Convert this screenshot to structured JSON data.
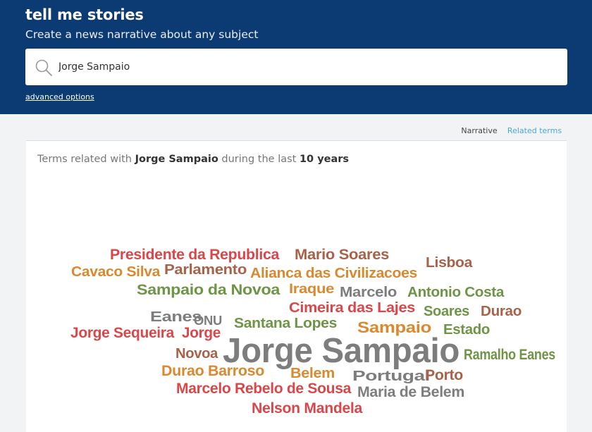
{
  "header": {
    "title": "tell me stories",
    "subtitle": "Create a news narrative about any subject",
    "advanced_link": "advanced options"
  },
  "search": {
    "value": "Jorge Sampaio",
    "icon": "search-icon"
  },
  "tabs": [
    {
      "label": "Narrative",
      "active": false
    },
    {
      "label": "Related terms",
      "active": true
    }
  ],
  "panel": {
    "heading_prefix": "Terms related with",
    "heading_term": "Jorge Sampaio",
    "heading_middle": "during the last",
    "heading_period": "10 years"
  },
  "colors": {
    "header_bg": "#0c3a72",
    "active_tab": "#4aa8d8",
    "cloud_red": "#d9474a",
    "cloud_orange": "#d9892f",
    "cloud_brown": "#a8624a",
    "cloud_green": "#6e9446",
    "cloud_gray": "#7d7d7d"
  },
  "word_cloud": [
    {
      "text": "Presidente da Republica",
      "color": "#d9474a"
    },
    {
      "text": "Mario Soares",
      "color": "#a8624a"
    },
    {
      "text": "Lisboa",
      "color": "#a8624a"
    },
    {
      "text": "Cavaco Silva",
      "color": "#d9892f"
    },
    {
      "text": "Parlamento",
      "color": "#a8624a"
    },
    {
      "text": "Alianca das Civilizacoes",
      "color": "#d9892f"
    },
    {
      "text": "Sampaio da Novoa",
      "color": "#6e9446"
    },
    {
      "text": "Iraque",
      "color": "#d9892f"
    },
    {
      "text": "Marcelo",
      "color": "#7d7d7d"
    },
    {
      "text": "Antonio Costa",
      "color": "#6e9446"
    },
    {
      "text": "Cimeira das Lajes",
      "color": "#d9474a"
    },
    {
      "text": "Eanes",
      "color": "#7d7d7d"
    },
    {
      "text": "ONU",
      "color": "#7d7d7d"
    },
    {
      "text": "Soares",
      "color": "#6e9446"
    },
    {
      "text": "Durao",
      "color": "#a8624a"
    },
    {
      "text": "Santana Lopes",
      "color": "#6e9446"
    },
    {
      "text": "Jorge Sequeira",
      "color": "#d9474a"
    },
    {
      "text": "Jorge",
      "color": "#d9474a"
    },
    {
      "text": "Sampaio",
      "color": "#d9892f"
    },
    {
      "text": "Estado",
      "color": "#6e9446"
    },
    {
      "text": "Novoa",
      "color": "#a8624a"
    },
    {
      "text": "Jorge Sampaio",
      "color": "#7d7d7d"
    },
    {
      "text": "Ramalho Eanes",
      "color": "#6e9446"
    },
    {
      "text": "Durao Barroso",
      "color": "#d9892f"
    },
    {
      "text": "Belem",
      "color": "#d9892f"
    },
    {
      "text": "Portugal",
      "color": "#7d7d7d"
    },
    {
      "text": "Porto",
      "color": "#a8624a"
    },
    {
      "text": "Marcelo Rebelo de Sousa",
      "color": "#d9474a"
    },
    {
      "text": "Maria de Belem",
      "color": "#7d7d7d"
    },
    {
      "text": "Nelson Mandela",
      "color": "#d9474a"
    }
  ]
}
